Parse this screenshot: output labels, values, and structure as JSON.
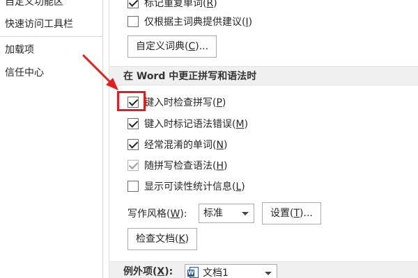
{
  "sidebar": {
    "items": [
      {
        "label": "自定义功能区"
      },
      {
        "label": "快速访问工具栏"
      },
      {
        "label": "加载项"
      },
      {
        "label": "信任中心"
      }
    ]
  },
  "top_options": {
    "flag_repeated": {
      "label_pre": "标记重复单词(",
      "key": "R",
      "label_post": ")",
      "checked": true
    },
    "main_dict_only": {
      "label_pre": "仅根据主词典提供建议(",
      "key": "I",
      "label_post": ")",
      "checked": false
    },
    "custom_dict_button": {
      "label_pre": "自定义词典(",
      "key": "C",
      "label_post": ")..."
    }
  },
  "word_section": {
    "title": "在 Word 中更正拼写和语法时",
    "options": [
      {
        "label_pre": "键入时检查拼写(",
        "key": "P",
        "label_post": ")",
        "checked": true,
        "disabled": false
      },
      {
        "label_pre": "键入时标记语法错误(",
        "key": "M",
        "label_post": ")",
        "checked": true,
        "disabled": false
      },
      {
        "label_pre": "经常混淆的单词(",
        "key": "N",
        "label_post": ")",
        "checked": true,
        "disabled": false
      },
      {
        "label_pre": "随拼写检查语法(",
        "key": "H",
        "label_post": ")",
        "checked": true,
        "disabled": true
      },
      {
        "label_pre": "显示可读性统计信息(",
        "key": "L",
        "label_post": ")",
        "checked": false,
        "disabled": false
      }
    ],
    "writing_style": {
      "label_pre": "写作风格(",
      "key": "W",
      "label_post": "):",
      "value": "标准",
      "settings_button": {
        "label_pre": "设置(",
        "key": "T",
        "label_post": ")..."
      }
    },
    "check_doc_button": {
      "label_pre": "检查文档(",
      "key": "K",
      "label_post": ")"
    }
  },
  "exceptions": {
    "label_pre": "例外项(",
    "key": "X",
    "label_post": "):",
    "document": "文档1",
    "icon": "word-doc-icon"
  },
  "colors": {
    "highlight": "#e02020",
    "section_bg": "#f0f0f0"
  }
}
